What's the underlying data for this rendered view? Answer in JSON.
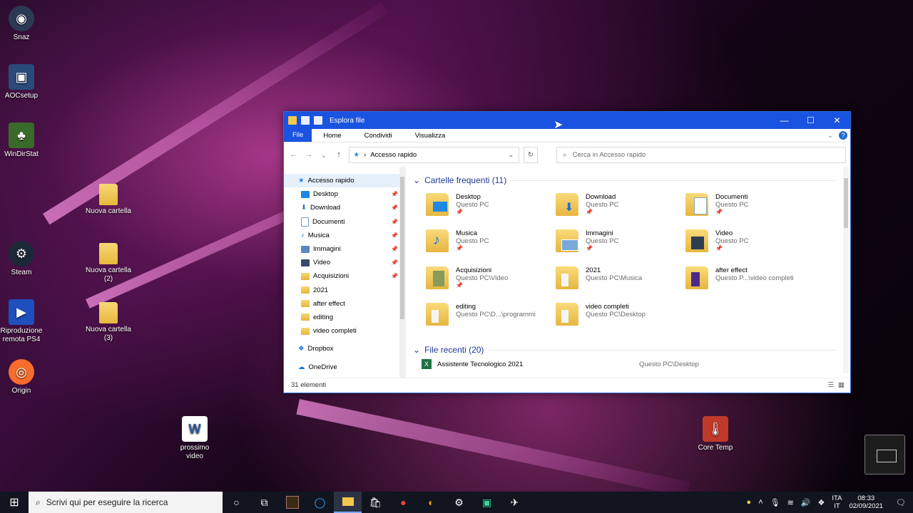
{
  "desktop": {
    "icons": [
      {
        "label": "Snaz"
      },
      {
        "label": "AOCsetup"
      },
      {
        "label": "WinDirStat"
      },
      {
        "label": "Nuova cartella"
      },
      {
        "label": "Steam"
      },
      {
        "label": "Nuova cartella (2)"
      },
      {
        "label": "Riproduzione remota PS4"
      },
      {
        "label": "Nuova cartella (3)"
      },
      {
        "label": "Origin"
      },
      {
        "label": "prossimo video"
      },
      {
        "label": "Core Temp"
      }
    ]
  },
  "window": {
    "title": "Esplora file",
    "ribbon_tabs": [
      "File",
      "Home",
      "Condividi",
      "Visualizza"
    ],
    "address": "Accesso rapido",
    "search_placeholder": "Cerca in Accesso rapido",
    "nav_items": [
      {
        "label": "Accesso rapido",
        "icon": "star-icon",
        "pinned": false
      },
      {
        "label": "Desktop",
        "icon": "desktop-icon",
        "pinned": true
      },
      {
        "label": "Download",
        "icon": "download-icon",
        "pinned": true
      },
      {
        "label": "Documenti",
        "icon": "documents-icon",
        "pinned": true
      },
      {
        "label": "Musica",
        "icon": "music-icon",
        "pinned": true
      },
      {
        "label": "Immagini",
        "icon": "pictures-icon",
        "pinned": true
      },
      {
        "label": "Video",
        "icon": "video-icon",
        "pinned": true
      },
      {
        "label": "Acquisizioni",
        "icon": "folder-icon",
        "pinned": true
      },
      {
        "label": "2021",
        "icon": "folder-icon",
        "pinned": false
      },
      {
        "label": "after effect",
        "icon": "folder-icon",
        "pinned": false
      },
      {
        "label": "editing",
        "icon": "folder-icon",
        "pinned": false
      },
      {
        "label": "video completi",
        "icon": "folder-icon",
        "pinned": false
      },
      {
        "label": "Dropbox",
        "icon": "dropbox-icon",
        "pinned": false
      },
      {
        "label": "OneDrive",
        "icon": "onedrive-icon",
        "pinned": false
      }
    ],
    "frequent_title": "Cartelle frequenti (11)",
    "frequent": [
      {
        "name": "Desktop",
        "path": "Questo PC"
      },
      {
        "name": "Download",
        "path": "Questo PC"
      },
      {
        "name": "Documenti",
        "path": "Questo PC"
      },
      {
        "name": "Musica",
        "path": "Questo PC"
      },
      {
        "name": "Immagini",
        "path": "Questo PC"
      },
      {
        "name": "Video",
        "path": "Questo PC"
      },
      {
        "name": "Acquisizioni",
        "path": "Questo PC\\Video"
      },
      {
        "name": "2021",
        "path": "Questo PC\\Musica"
      },
      {
        "name": "after effect",
        "path": "Questo P...\\video completi"
      },
      {
        "name": "editing",
        "path": "Questo PC\\D...\\programmi"
      },
      {
        "name": "video completi",
        "path": "Questo PC\\Desktop"
      }
    ],
    "recent_title": "File recenti (20)",
    "recent": [
      {
        "name": "Assistente Tecnologico 2021",
        "path": "Questo PC\\Desktop"
      }
    ],
    "status": "31 elementi"
  },
  "taskbar": {
    "search_placeholder": "Scrivi qui per eseguire la ricerca",
    "lang_top": "ITA",
    "lang_bottom": "IT",
    "time": "08:33",
    "date": "02/09/2021"
  }
}
